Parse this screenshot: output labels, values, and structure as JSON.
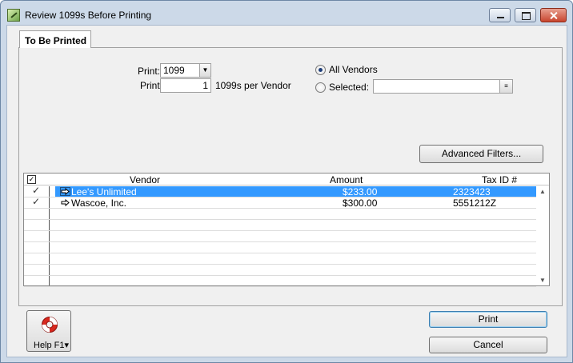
{
  "window": {
    "title": "Review 1099s Before Printing"
  },
  "tab": {
    "label": "To Be Printed"
  },
  "form": {
    "print_label": "Print:",
    "print_value": "1099",
    "print2_label": "Print",
    "copies_value": "1",
    "copies_suffix": "1099s per Vendor",
    "all_vendors_label": "All Vendors",
    "selected_label": "Selected:",
    "selected_value": ""
  },
  "buttons": {
    "advanced_filters": "Advanced Filters...",
    "print": "Print",
    "cancel": "Cancel",
    "help": "Help F1"
  },
  "grid": {
    "columns": [
      "Vendor",
      "Amount",
      "Tax ID #"
    ],
    "rows": [
      {
        "vendor": "Lee's Unlimited",
        "amount": "$233.00",
        "tax_id": "2323423",
        "selected": true,
        "checked": true
      },
      {
        "vendor": "Wascoe, Inc.",
        "amount": "$300.00",
        "tax_id": "5551212Z",
        "selected": false,
        "checked": true
      }
    ]
  },
  "colors": {
    "selection": "#3399ff",
    "title_bar": "#ccd9e8"
  }
}
